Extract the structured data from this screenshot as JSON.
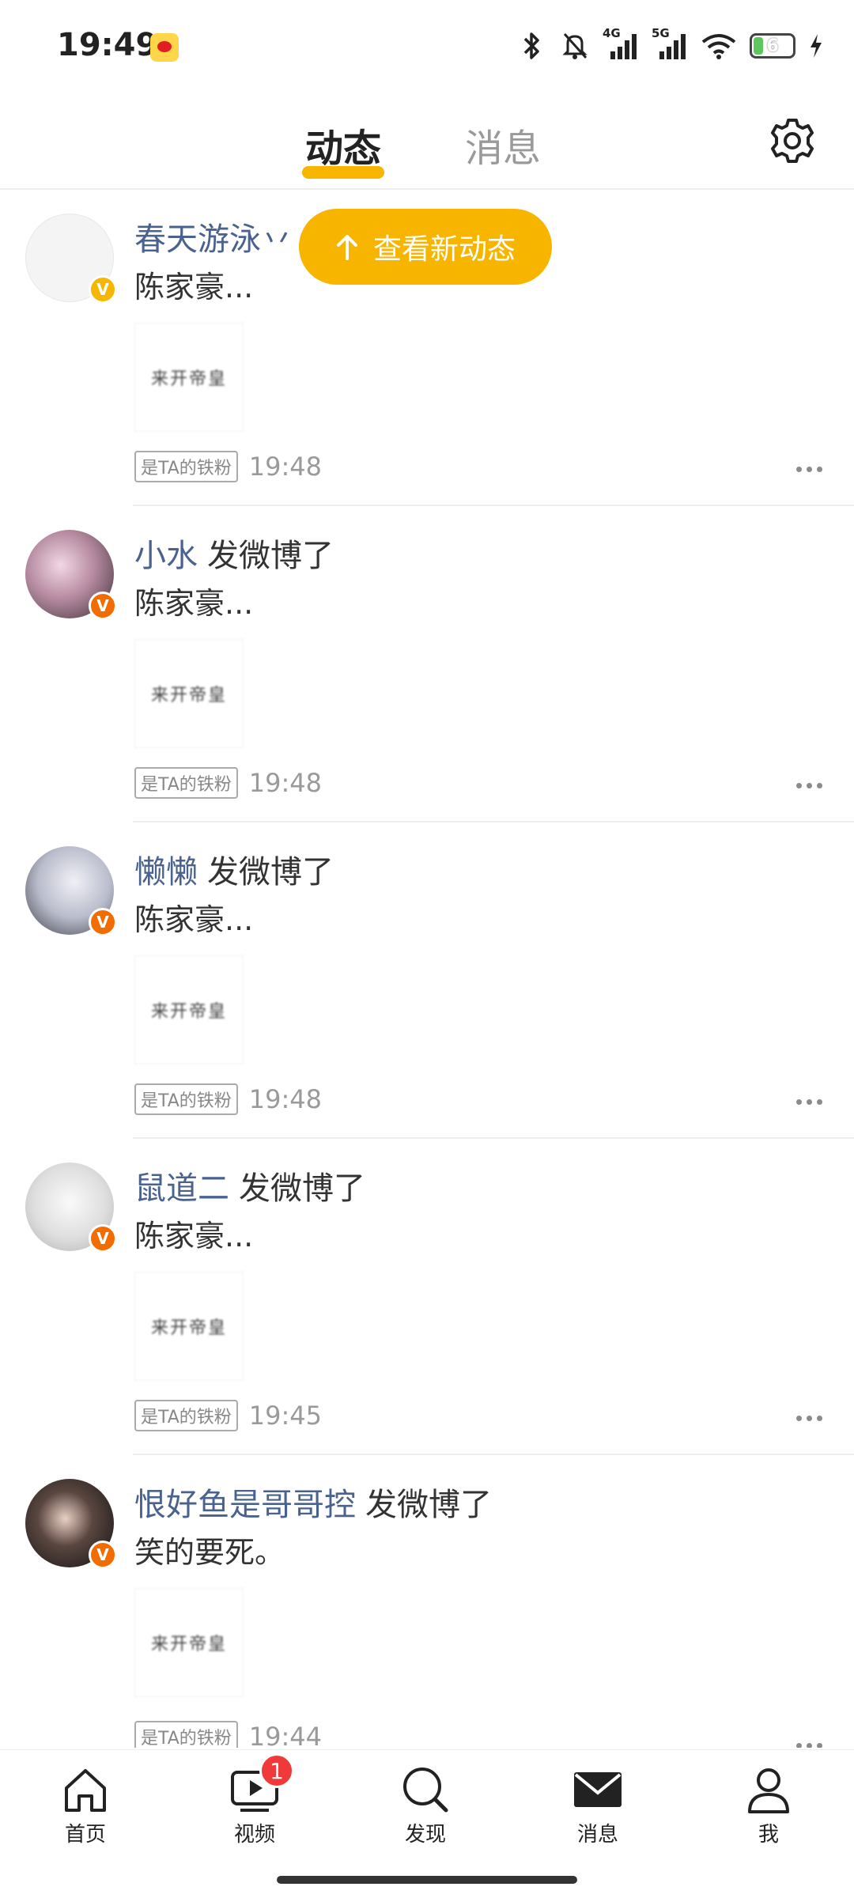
{
  "status_bar": {
    "time": "19:49",
    "icons": [
      "weibo-icon",
      "bluetooth-icon",
      "mute-icon",
      "signal-4g-icon",
      "signal-5g-icon",
      "wifi-icon",
      "battery-icon",
      "charging-icon"
    ],
    "network_1": "4G",
    "network_2": "5G",
    "battery_level": "6"
  },
  "header": {
    "tabs": [
      {
        "label": "动态",
        "active": true
      },
      {
        "label": "消息",
        "active": false
      }
    ],
    "settings_icon": "gear-icon"
  },
  "new_posts_pill": {
    "label": "查看新动态",
    "icon": "arrow-up-icon"
  },
  "thumbnail_text": "来开帝皇",
  "feed": [
    {
      "name": "春天游泳丷",
      "action": "",
      "snippet": "陈家豪...",
      "fan_tag": "是TA的铁粉",
      "time": "19:48",
      "badge": "V",
      "badge_color": "#f5b700"
    },
    {
      "name": "小水",
      "action": "发微博了",
      "snippet": "陈家豪...",
      "fan_tag": "是TA的铁粉",
      "time": "19:48",
      "badge": "V",
      "badge_color": "#f26c00"
    },
    {
      "name": "懒懒",
      "action": "发微博了",
      "snippet": "陈家豪...",
      "fan_tag": "是TA的铁粉",
      "time": "19:48",
      "badge": "V",
      "badge_color": "#f26c00"
    },
    {
      "name": "鼠道二",
      "action": "发微博了",
      "snippet": "陈家豪...",
      "fan_tag": "是TA的铁粉",
      "time": "19:45",
      "badge": "V",
      "badge_color": "#f26c00"
    },
    {
      "name": "恨好鱼是哥哥控",
      "action": "发微博了",
      "snippet": "笑的要死。",
      "fan_tag": "是TA的铁粉",
      "time": "19:44",
      "badge": "V",
      "badge_color": "#f26c00"
    }
  ],
  "bottom_nav": [
    {
      "label": "首页",
      "icon": "home-icon"
    },
    {
      "label": "视频",
      "icon": "video-icon",
      "badge": "1"
    },
    {
      "label": "发现",
      "icon": "search-icon"
    },
    {
      "label": "消息",
      "icon": "mail-icon",
      "active": true
    },
    {
      "label": "我",
      "icon": "profile-icon"
    }
  ],
  "colors": {
    "accent": "#f7b500",
    "username": "#4a628f",
    "badge_red": "#f03a3a"
  }
}
